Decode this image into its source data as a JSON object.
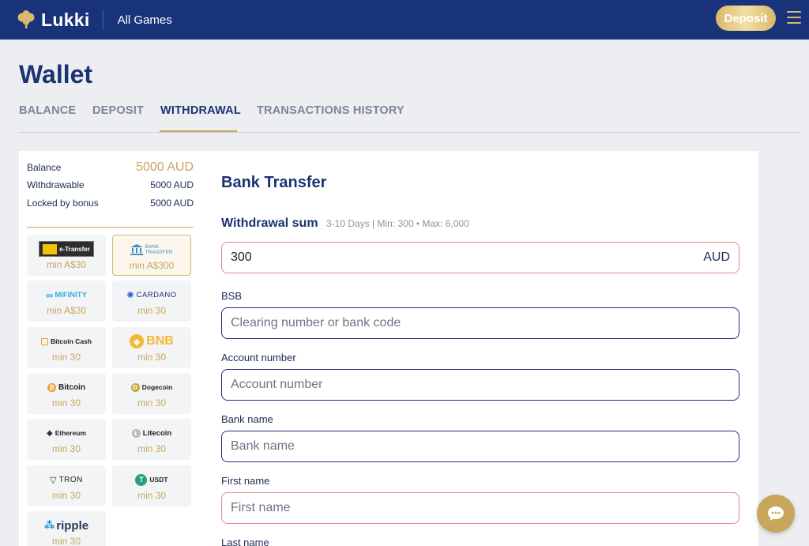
{
  "header": {
    "brand": "Lukki",
    "nav_all_games": "All Games",
    "deposit_label": "Deposit"
  },
  "page": {
    "title": "Wallet",
    "tabs": [
      {
        "label": "BALANCE",
        "active": false
      },
      {
        "label": "DEPOSIT",
        "active": false
      },
      {
        "label": "WITHDRAWAL",
        "active": true
      },
      {
        "label": "TRANSACTIONS HISTORY",
        "active": false
      }
    ]
  },
  "summary": {
    "balance_label": "Balance",
    "balance_value": "5000 AUD",
    "withdrawable_label": "Withdrawable",
    "withdrawable_value": "5000 AUD",
    "locked_label": "Locked by bonus",
    "locked_value": "5000 AUD"
  },
  "methods": [
    {
      "name": "e-Transfer",
      "min": "min A$30",
      "selected": false
    },
    {
      "name": "BANK TRANSFER",
      "min": "min A$300",
      "selected": true
    },
    {
      "name": "MIFINITY",
      "min": "min A$30",
      "selected": false
    },
    {
      "name": "CARDANO",
      "min": "min 30",
      "selected": false
    },
    {
      "name": "Bitcoin Cash",
      "min": "min 30",
      "selected": false
    },
    {
      "name": "BNB",
      "min": "min 30",
      "selected": false
    },
    {
      "name": "Bitcoin",
      "min": "min 30",
      "selected": false
    },
    {
      "name": "Dogecoin",
      "min": "min 30",
      "selected": false
    },
    {
      "name": "Ethereum",
      "min": "min 30",
      "selected": false
    },
    {
      "name": "Litecoin",
      "min": "min 30",
      "selected": false
    },
    {
      "name": "TRON",
      "min": "min 30",
      "selected": false
    },
    {
      "name": "USDT",
      "min": "min 30",
      "selected": false
    },
    {
      "name": "ripple",
      "min": "min 30",
      "selected": false
    }
  ],
  "form": {
    "title": "Bank Transfer",
    "sum_label": "Withdrawal sum",
    "sum_hint": "3-10 Days | Min: 300 • Max: 6,000",
    "sum_value": "300",
    "sum_currency": "AUD",
    "bsb_label": "BSB",
    "bsb_placeholder": "Clearing number or bank code",
    "account_label": "Account number",
    "account_placeholder": "Account number",
    "bank_label": "Bank name",
    "bank_placeholder": "Bank name",
    "first_label": "First name",
    "first_placeholder": "First name",
    "last_label": "Last name"
  },
  "colors": {
    "header_bg": "#19337a",
    "accent_gold": "#c8a75c",
    "text_navy": "#1b3372",
    "error_border": "#e18a88"
  }
}
